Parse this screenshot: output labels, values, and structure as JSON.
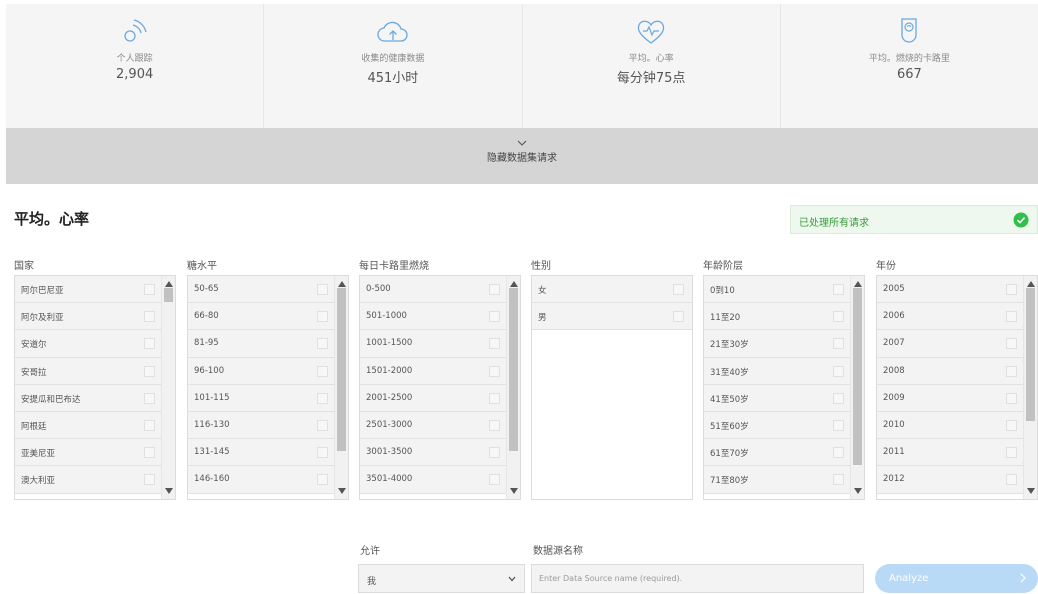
{
  "stats": [
    {
      "icon": "signal-icon",
      "label": "个人跟踪",
      "value": "2,904"
    },
    {
      "icon": "cloud-upload-icon",
      "label": "收集的健康数据",
      "value": "451小时"
    },
    {
      "icon": "heart-rate-icon",
      "label": "平均。心率",
      "value": "每分钟75点"
    },
    {
      "icon": "calorie-icon",
      "label": "平均。燃烧的卡路里",
      "value": "667"
    }
  ],
  "toggle_label": "隐藏数据集请求",
  "chart_title": "平均。心率",
  "status": {
    "text": "已处理所有请求",
    "color": "#3a9b3a"
  },
  "filters": [
    {
      "label": "国家",
      "items": [
        "阿尔巴尼亚",
        "阿尔及利亚",
        "安道尔",
        "安哥拉",
        "安提瓜和巴布达",
        "阿根廷",
        "亚美尼亚",
        "澳大利亚"
      ],
      "scroll": 0.0,
      "thumb": 0.07
    },
    {
      "label": "糖水平",
      "items": [
        "50-65",
        "66-80",
        "81-95",
        "96-100",
        "101-115",
        "116-130",
        "131-145",
        "146-160"
      ],
      "scroll": 0.0,
      "thumb": 0.82
    },
    {
      "label": "每日卡路里燃烧",
      "items": [
        "0-500",
        "501-1000",
        "1001-1500",
        "1501-2000",
        "2001-2500",
        "2501-3000",
        "3001-3500",
        "3501-4000"
      ],
      "scroll": 0.0,
      "thumb": 0.82
    },
    {
      "label": "性别",
      "items": [
        "女",
        "男"
      ],
      "scroll": null,
      "thumb": null
    },
    {
      "label": "年龄阶层",
      "items": [
        "0到10",
        "11至20",
        "21至30岁",
        "31至40岁",
        "41至50岁",
        "51至60岁",
        "61至70岁",
        "71至80岁"
      ],
      "scroll": 0.0,
      "thumb": 0.89
    },
    {
      "label": "年份",
      "items": [
        "2005",
        "2006",
        "2007",
        "2008",
        "2009",
        "2010",
        "2011",
        "2012"
      ],
      "scroll": 0.0,
      "thumb": 0.67
    }
  ],
  "allow": {
    "label": "允许",
    "value": "我"
  },
  "source": {
    "label": "数据源名称",
    "placeholder": "Enter Data Source name (required)."
  },
  "analyze_label": "Analyze",
  "colors": {
    "accent": "#b9daf7",
    "success": "#3a9b3a",
    "checkbox_green": "#2fbf4a"
  }
}
